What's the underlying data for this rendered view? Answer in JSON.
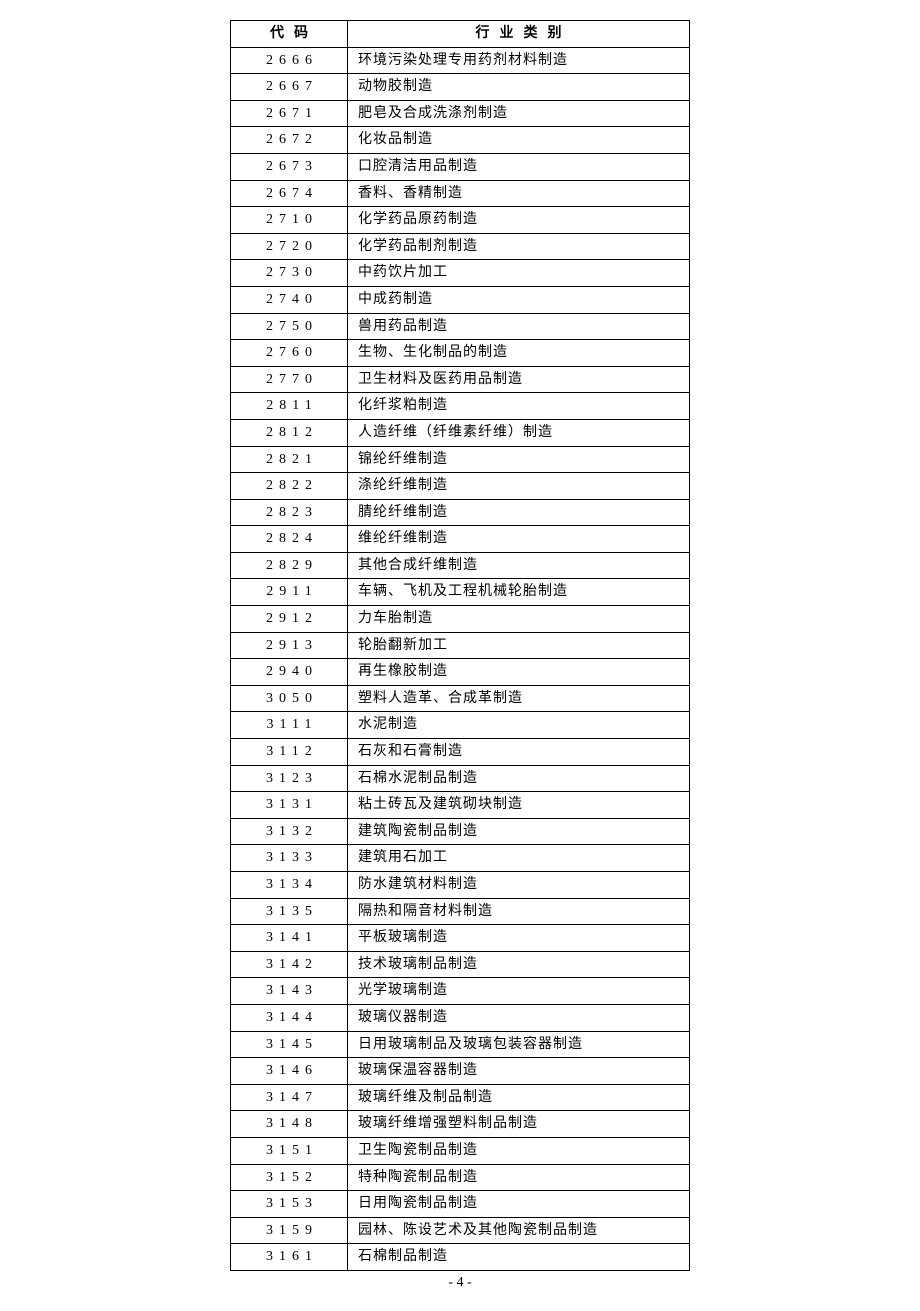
{
  "table": {
    "headers": {
      "code": "代码",
      "category": "行业类别"
    },
    "rows": [
      {
        "code": "2666",
        "category": "环境污染处理专用药剂材料制造"
      },
      {
        "code": "2667",
        "category": "动物胶制造"
      },
      {
        "code": "2671",
        "category": "肥皂及合成洗涤剂制造"
      },
      {
        "code": "2672",
        "category": "化妆品制造"
      },
      {
        "code": "2673",
        "category": "口腔清洁用品制造"
      },
      {
        "code": "2674",
        "category": "香料、香精制造"
      },
      {
        "code": "2710",
        "category": "化学药品原药制造"
      },
      {
        "code": "2720",
        "category": "化学药品制剂制造"
      },
      {
        "code": "2730",
        "category": "中药饮片加工"
      },
      {
        "code": "2740",
        "category": "中成药制造"
      },
      {
        "code": "2750",
        "category": "兽用药品制造"
      },
      {
        "code": "2760",
        "category": "生物、生化制品的制造"
      },
      {
        "code": "2770",
        "category": "卫生材料及医药用品制造"
      },
      {
        "code": "2811",
        "category": "化纤浆粕制造"
      },
      {
        "code": "2812",
        "category": "人造纤维（纤维素纤维）制造"
      },
      {
        "code": "2821",
        "category": "锦纶纤维制造"
      },
      {
        "code": "2822",
        "category": "涤纶纤维制造"
      },
      {
        "code": "2823",
        "category": "腈纶纤维制造"
      },
      {
        "code": "2824",
        "category": "维纶纤维制造"
      },
      {
        "code": "2829",
        "category": "其他合成纤维制造"
      },
      {
        "code": "2911",
        "category": "车辆、飞机及工程机械轮胎制造"
      },
      {
        "code": "2912",
        "category": "力车胎制造"
      },
      {
        "code": "2913",
        "category": "轮胎翻新加工"
      },
      {
        "code": "2940",
        "category": "再生橡胶制造"
      },
      {
        "code": "3050",
        "category": "塑料人造革、合成革制造"
      },
      {
        "code": "3111",
        "category": "水泥制造"
      },
      {
        "code": "3112",
        "category": "石灰和石膏制造"
      },
      {
        "code": "3123",
        "category": "石棉水泥制品制造"
      },
      {
        "code": "3131",
        "category": "粘土砖瓦及建筑砌块制造"
      },
      {
        "code": "3132",
        "category": "建筑陶瓷制品制造"
      },
      {
        "code": "3133",
        "category": "建筑用石加工"
      },
      {
        "code": "3134",
        "category": "防水建筑材料制造"
      },
      {
        "code": "3135",
        "category": "隔热和隔音材料制造"
      },
      {
        "code": "3141",
        "category": "平板玻璃制造"
      },
      {
        "code": "3142",
        "category": "技术玻璃制品制造"
      },
      {
        "code": "3143",
        "category": "光学玻璃制造"
      },
      {
        "code": "3144",
        "category": "玻璃仪器制造"
      },
      {
        "code": "3145",
        "category": "日用玻璃制品及玻璃包装容器制造"
      },
      {
        "code": "3146",
        "category": "玻璃保温容器制造"
      },
      {
        "code": "3147",
        "category": "玻璃纤维及制品制造"
      },
      {
        "code": "3148",
        "category": "玻璃纤维增强塑料制品制造"
      },
      {
        "code": "3151",
        "category": "卫生陶瓷制品制造"
      },
      {
        "code": "3152",
        "category": "特种陶瓷制品制造"
      },
      {
        "code": "3153",
        "category": "日用陶瓷制品制造"
      },
      {
        "code": "3159",
        "category": "园林、陈设艺术及其他陶瓷制品制造"
      },
      {
        "code": "3161",
        "category": "石棉制品制造"
      }
    ]
  },
  "page_number": "- 4 -"
}
